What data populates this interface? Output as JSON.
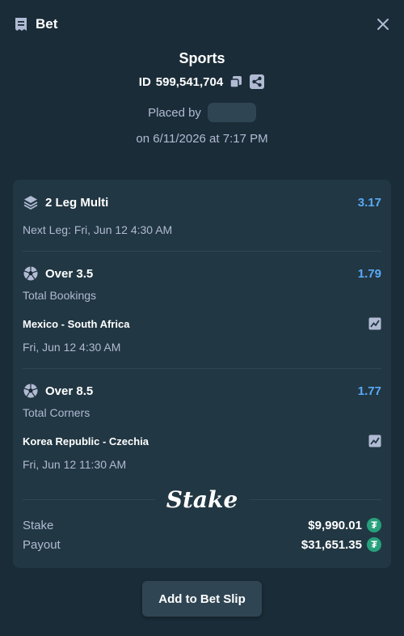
{
  "header": {
    "title": "Bet"
  },
  "summary": {
    "sport": "Sports",
    "id_prefix": "ID",
    "id_value": "599,541,704",
    "placed_by": "Placed by",
    "date_line": "on 6/11/2026 at 7:17 PM"
  },
  "multi": {
    "title": "2 Leg Multi",
    "odds": "3.17",
    "next_leg": "Next Leg: Fri, Jun 12 4:30 AM"
  },
  "legs": [
    {
      "title": "Over 3.5",
      "odds": "1.79",
      "market": "Total Bookings",
      "match": "Mexico - South Africa",
      "time": "Fri, Jun 12  4:30 AM"
    },
    {
      "title": "Over 8.5",
      "odds": "1.77",
      "market": "Total Corners",
      "match": "Korea Republic - Czechia",
      "time": "Fri, Jun 12  11:30 AM"
    }
  ],
  "brand": {
    "logo": "Stake"
  },
  "totals": {
    "stake_label": "Stake",
    "stake_amount": "$9,990.01",
    "payout_label": "Payout",
    "payout_amount": "$31,651.35",
    "currency_symbol": "₮"
  },
  "actions": {
    "add_label": "Add to Bet Slip"
  },
  "colors": {
    "background": "#1a2c38",
    "card": "#213743",
    "accent": "#5aa9f5",
    "tether": "#26a17b"
  }
}
